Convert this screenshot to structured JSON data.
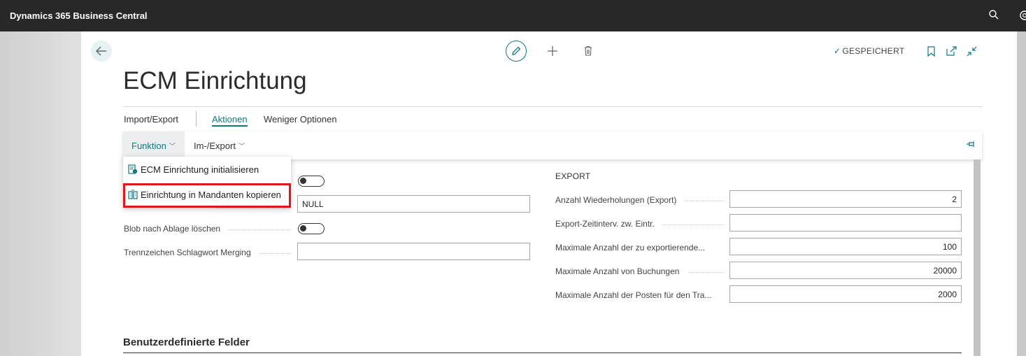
{
  "topbar": {
    "app_title": "Dynamics 365 Business Central",
    "icons": [
      "search-icon",
      "settings-icon"
    ]
  },
  "header": {
    "status": "GESPEICHERT",
    "icons": [
      "back-arrow-icon",
      "edit-pencil-icon",
      "plus-icon",
      "trash-icon",
      "bookmark-icon",
      "open-in-new-window-icon",
      "collapse-icon"
    ]
  },
  "page": {
    "title": "ECM Einrichtung"
  },
  "action_tabs": [
    {
      "label": "Import/Export"
    },
    {
      "label": "Aktionen",
      "active": true
    },
    {
      "label": "Weniger Optionen"
    }
  ],
  "ribbon": {
    "funktion": "Funktion",
    "im_export": "Im-/Export"
  },
  "dropdown": {
    "items": [
      {
        "label": "ECM Einrichtung initialisieren",
        "icon": "initialize-icon"
      },
      {
        "label": "Einrichtung in Mandanten kopieren",
        "icon": "copy-to-company-icon",
        "highlighted": true
      }
    ]
  },
  "left_fields": {
    "toggle1": {
      "value": false
    },
    "field2": {
      "value": "NULL"
    },
    "blob_delete": {
      "label": "Blob nach Ablage löschen",
      "value": false
    },
    "separator": {
      "label": "Trennzeichen Schlagwort Merging",
      "value": ""
    }
  },
  "export": {
    "heading": "EXPORT",
    "fields": [
      {
        "label": "Anzahl Wiederholungen (Export)",
        "value": "2"
      },
      {
        "label": "Export-Zeitinterv. zw. Eintr.",
        "value": ""
      },
      {
        "label": "Maximale Anzahl der zu exportierende...",
        "value": "100"
      },
      {
        "label": "Maximale Anzahl von Buchungen",
        "value": "20000"
      },
      {
        "label": "Maximale Anzahl der Posten für den Tra...",
        "value": "2000"
      }
    ]
  },
  "custom_section": {
    "title": "Benutzerdefinierte Felder"
  },
  "colors": {
    "accent": "#0e7a85",
    "topbar": "#282828",
    "highlight": "#e0151e"
  }
}
